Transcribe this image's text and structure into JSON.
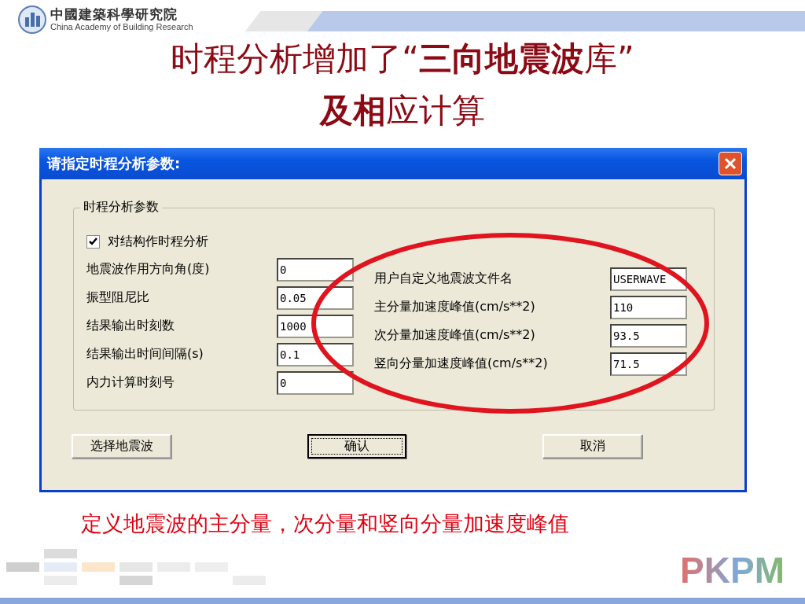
{
  "header": {
    "org_name": "中國建築科學研究院",
    "org_name_en": "China Academy of Building Research"
  },
  "title_lines": [
    "时程分析增加了“**三向地震波**库”",
    "**及相**应计算"
  ],
  "dialog": {
    "title": "请指定时程分析参数:",
    "group": {
      "label": "时程分析参数",
      "checkbox": {
        "label": "对结构作时程分析",
        "checked": true
      },
      "left_fields": [
        {
          "label": "地震波作用方向角(度)",
          "value": "0"
        },
        {
          "label": "振型阻尼比",
          "value": "0.05"
        },
        {
          "label": "结果输出时刻数",
          "value": "1000"
        },
        {
          "label": "结果输出时间间隔(s)",
          "value": "0.1"
        },
        {
          "label": "内力计算时刻号",
          "value": "0"
        }
      ],
      "right_fields": [
        {
          "label": "用户自定义地震波文件名",
          "value": "USERWAVE"
        },
        {
          "label": "主分量加速度峰值(cm/s**2)",
          "value": "110"
        },
        {
          "label": "次分量加速度峰值(cm/s**2)",
          "value": "93.5"
        },
        {
          "label": "竖向分量加速度峰值(cm/s**2)",
          "value": "71.5"
        }
      ]
    },
    "buttons": [
      {
        "label": "选择地震波",
        "focused": false
      },
      {
        "label": "确认",
        "focused": true
      },
      {
        "label": "取消",
        "focused": false
      }
    ]
  },
  "caption": "定义地震波的主分量，次分量和竖向分量加速度峰值",
  "footer": {
    "logo": "PKPM"
  }
}
